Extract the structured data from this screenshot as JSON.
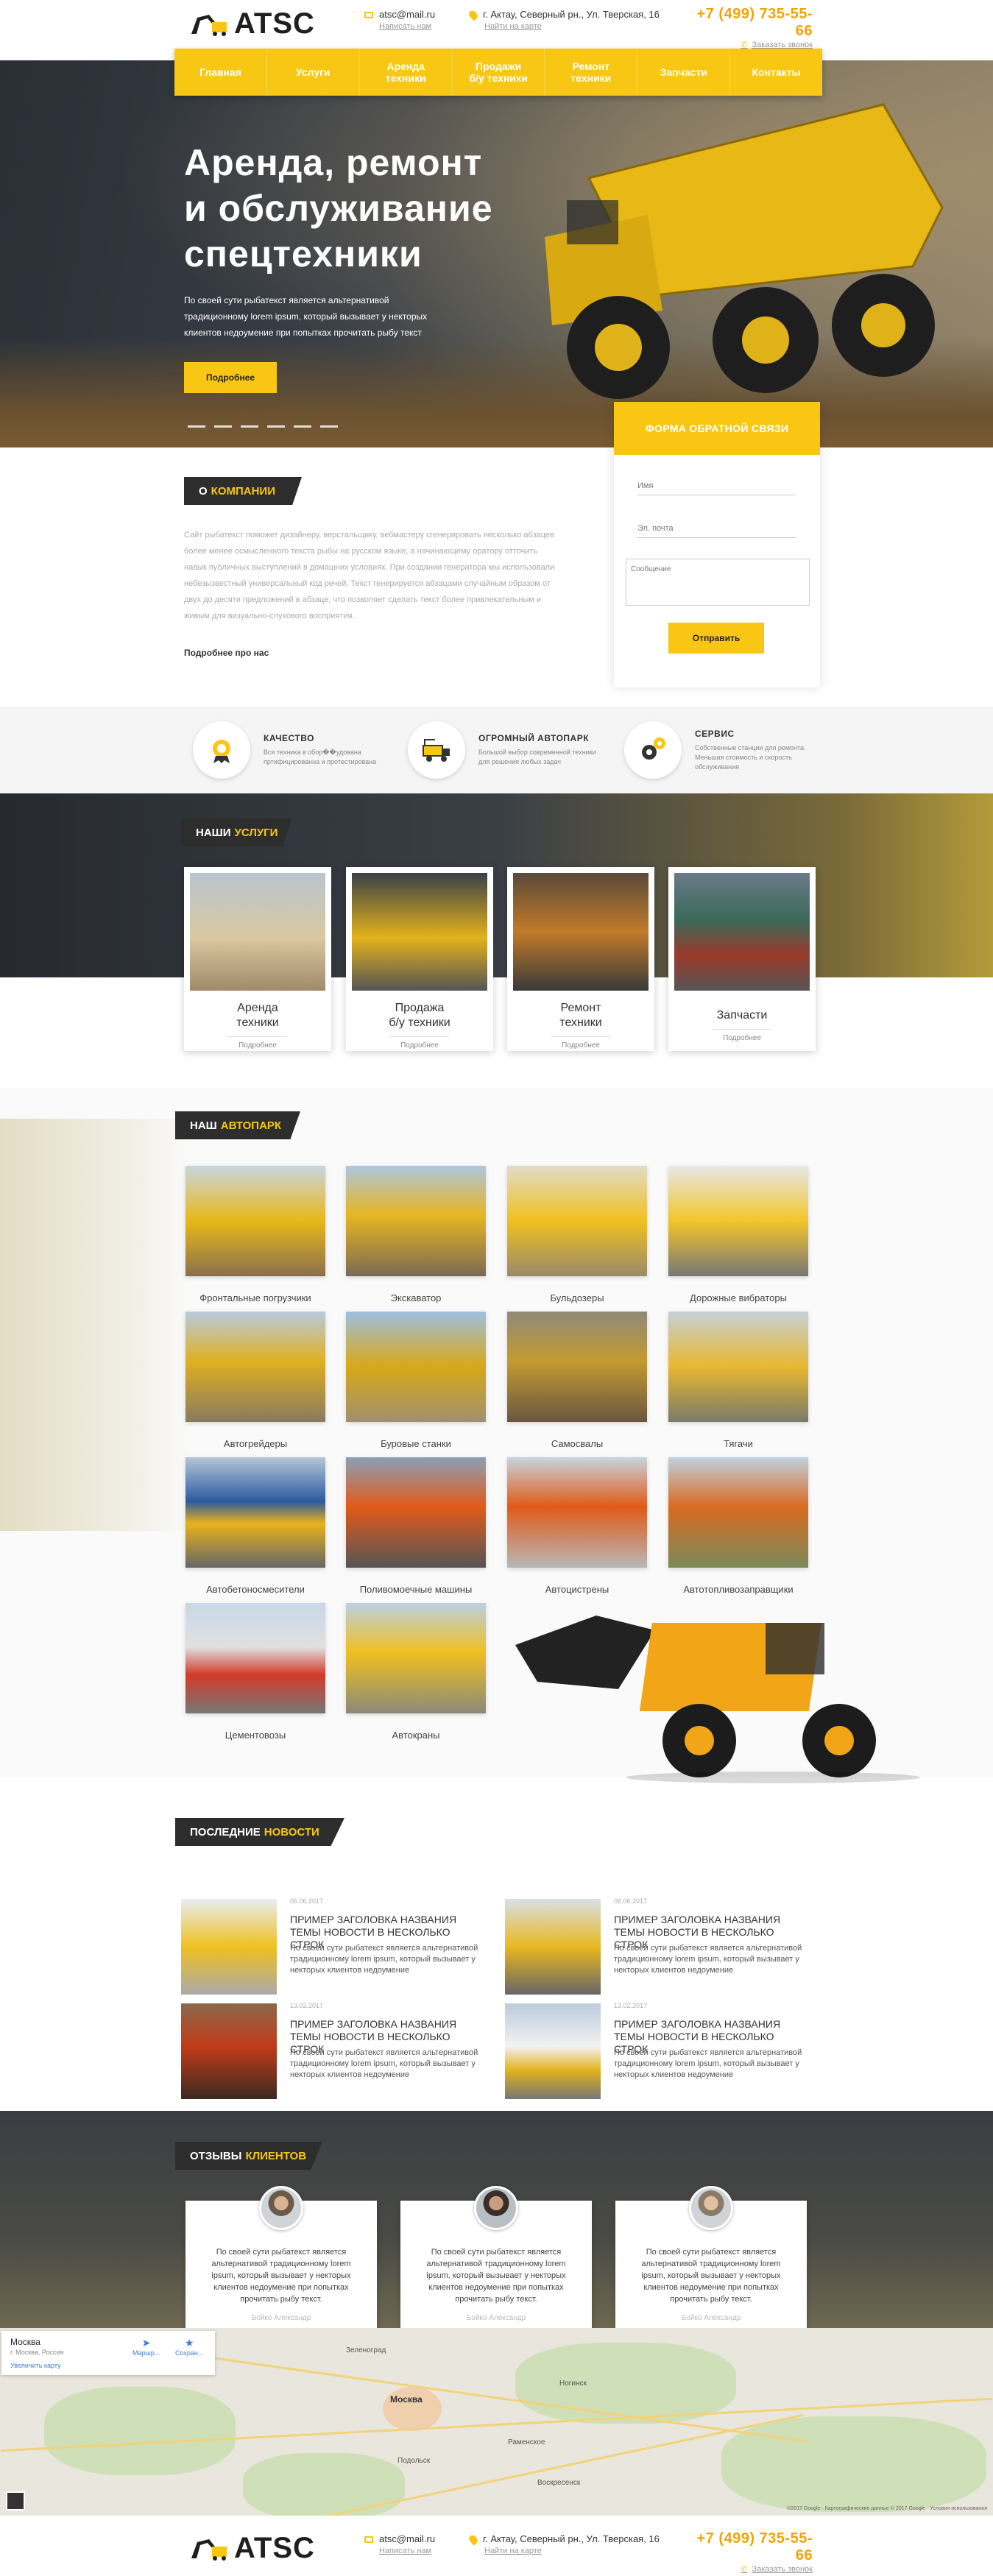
{
  "header": {
    "logo_text": "ATSC",
    "email": "atsc@mail.ru",
    "write_link": "Написать нам",
    "address": "г. Актау, Северный рн., Ул. Тверская, 16",
    "map_link": "Найти на карте",
    "phone": "+7 (499) 735-55-66",
    "call_link": "Заказать звонок"
  },
  "nav": {
    "items": [
      {
        "label": "Главная"
      },
      {
        "label": "Услуги"
      },
      {
        "label": "Аренда\nтехники"
      },
      {
        "label": "Продажи\nб/у техники"
      },
      {
        "label": "Ремонт\nтехники"
      },
      {
        "label": "Запчасти"
      },
      {
        "label": "Контакты"
      }
    ]
  },
  "hero": {
    "title": "Аренда, ремонт\nи обслуживание\nспецтехники",
    "text": "По своей сути рыбатекст является альтернативой традиционному lorem ipsum, который вызывает у некторых клиентов недоумение при попытках прочитать рыбу текст",
    "button": "Подробнее"
  },
  "form": {
    "title": "ФОРМА ОБРАТНОЙ СВЯЗИ",
    "name_placeholder": "Имя",
    "email_placeholder": "Эл. почта",
    "message_placeholder": "Сообщение",
    "submit": "Отправить"
  },
  "about": {
    "label_a": "О",
    "label_b": "КОМПАНИИ",
    "text": "Сайт рыбатекст поможет дизайнеру, верстальщику, вебмастеру сгенерировать несколько абзацев более менее осмысленного текста рыбы на русском языке, а начинающему оратору отточить навык публичных выступлений в домашних условиях. При создании генератора мы использовали небезызвестный универсальный код речей. Текст генерируется абзацами случайным образом от двух до десяти предложений в абзаце, что позволяет сделать текст более привлекательным и живым для визуально-слухового восприятия.",
    "more": "Подробнее про нас"
  },
  "features": [
    {
      "title": "КАЧЕСТВО",
      "text": "Вся техника в обор��удована пртифицированна и протестирована",
      "icon": "medal-icon"
    },
    {
      "title": "ОГРОМНЫЙ АВТОПАРК",
      "text": "Большой выбор современной техники для решения любых задач",
      "icon": "truck-icon"
    },
    {
      "title": "СЕРВИС",
      "text": "Собственные станции для ремонта. Меньшая стоимость и скорость обслуживания",
      "icon": "gears-icon"
    }
  ],
  "services": {
    "label_a": "НАШИ",
    "label_b": "УСЛУГИ",
    "items": [
      {
        "name": "Аренда\nтехники",
        "more": "Подробнее"
      },
      {
        "name": "Продажа\nб/у техники",
        "more": "Подробнее"
      },
      {
        "name": "Ремонт\nтехники",
        "more": "Подробнее"
      },
      {
        "name": "Запчасти",
        "more": "Подробнее"
      }
    ]
  },
  "park": {
    "label_a": "НАШ",
    "label_b": "АВТОПАРК",
    "items": [
      "Фронтальные погрузчики",
      "Экскаватор",
      "Бульдозеры",
      "Дорожные вибраторы",
      "Автогрейдеры",
      "Буровые станки",
      "Самосвалы",
      "Тягачи",
      "Автобетоносмесители",
      "Поливомоечные машины",
      "Автоцистрены",
      "Автотопливозаправщики",
      "Цементовозы",
      "Автокраны"
    ]
  },
  "news": {
    "label_a": "ПОСЛЕДНИЕ",
    "label_b": "НОВОСТИ",
    "items": [
      {
        "date": "06.06.2017",
        "title": "ПРИМЕР ЗАГОЛОВКА НАЗВАНИЯ ТЕМЫ НОВОСТИ В НЕСКОЛЬКО СТРОК",
        "text": "По своей сути рыбатекст является альтернативой традиционному lorem ipsum, который вызывает у некторых клиентов недоумение"
      },
      {
        "date": "06.06.2017",
        "title": "ПРИМЕР ЗАГОЛОВКА НАЗВАНИЯ ТЕМЫ НОВОСТИ В НЕСКОЛЬКО СТРОК",
        "text": "По своей сути рыбатекст является альтернативой традиционному lorem ipsum, который вызывает у некторых клиентов недоумение"
      },
      {
        "date": "13.02.2017",
        "title": "ПРИМЕР ЗАГОЛОВКА НАЗВАНИЯ ТЕМЫ НОВОСТИ В НЕСКОЛЬКО СТРОК",
        "text": "По своей сути рыбатекст является альтернативой традиционному lorem ipsum, который вызывает у некторых клиентов недоумение"
      },
      {
        "date": "13.02.2017",
        "title": "ПРИМЕР ЗАГОЛОВКА НАЗВАНИЯ ТЕМЫ НОВОСТИ В НЕСКОЛЬКО СТРОК",
        "text": "По своей сути рыбатекст является альтернативой традиционному lorem ipsum, который вызывает у некторых клиентов недоумение"
      }
    ]
  },
  "reviews": {
    "label_a": "ОТЗЫВЫ",
    "label_b": "КЛИЕНТОВ",
    "items": [
      {
        "text": "По своей сути рыбатекст является альтернативой традиционному lorem ipsum, который вызывает у некторых клиентов недоумение при попытках прочитать рыбу текст.",
        "author": "Бойко Александр"
      },
      {
        "text": "По своей сути рыбатекст является альтернативой традиционному lorem ipsum, который вызывает у некторых клиентов недоумение при попытках прочитать рыбу текст.",
        "author": "Бойко Александр"
      },
      {
        "text": "По своей сути рыбатекст является альтернативой традиционному lorem ipsum, который вызывает у некторых клиентов недоумение при попытках прочитать рыбу текст.",
        "author": "Бойко Александр"
      }
    ]
  },
  "map": {
    "city": "Москва",
    "region": "г. Москва, Россия",
    "enlarge": "Увеличить карту",
    "route": "Маршр...",
    "save": "Сохран...",
    "places": [
      "Москва",
      "Подольск",
      "Зеленоград",
      "Ногинск",
      "Раменское",
      "Воскресенск"
    ],
    "credits": "©2017 Google · Картографические данные © 2017 Google · Условия использования"
  },
  "colors": {
    "accent": "#f9c713",
    "dark": "#2d2d2d"
  }
}
